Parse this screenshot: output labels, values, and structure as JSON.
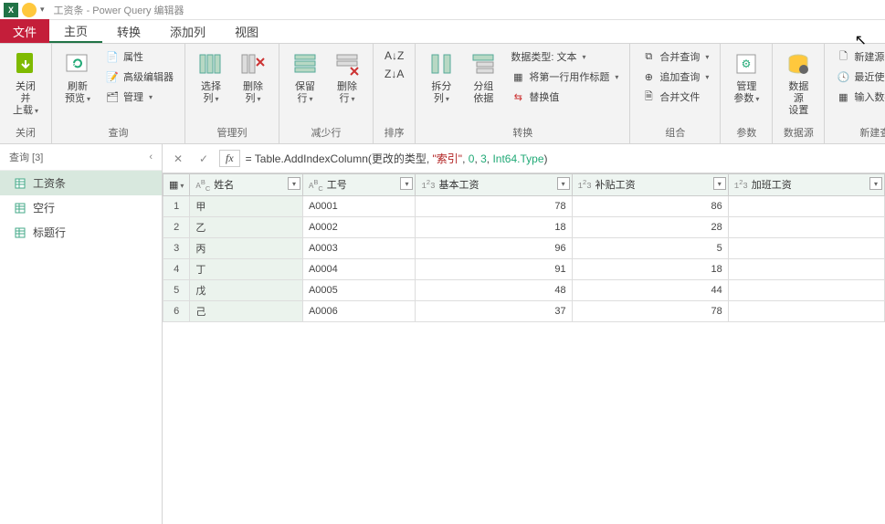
{
  "titlebar": {
    "title": "工资条 - Power Query 编辑器"
  },
  "tabs": {
    "file": "文件",
    "home": "主页",
    "transform": "转换",
    "addcol": "添加列",
    "view": "视图"
  },
  "ribbon": {
    "close_load": "关闭并\n上载",
    "close_group": "关闭",
    "refresh": "刷新\n预览",
    "props": "属性",
    "adv": "高级编辑器",
    "manage": "管理",
    "query_group": "查询",
    "choose_cols": "选择\n列",
    "remove_cols": "删除\n列",
    "managecols_group": "管理列",
    "keep_rows": "保留\n行",
    "remove_rows": "删除\n行",
    "reduce_group": "减少行",
    "sort_group": "排序",
    "split_col": "拆分\n列",
    "group_by": "分组\n依据",
    "datatype": "数据类型: 文本",
    "first_row": "将第一行用作标题",
    "replace": "替换值",
    "transform_group": "转换",
    "merge": "合并查询",
    "append": "追加查询",
    "combine_files": "合并文件",
    "combine_group": "组合",
    "params": "管理\n参数",
    "params_group": "参数",
    "ds_settings": "数据源\n设置",
    "ds_group": "数据源",
    "new_source": "新建源",
    "recent": "最近使用的源",
    "enter_data": "输入数据",
    "newq_group": "新建查询"
  },
  "queries": {
    "header": "查询 [3]",
    "items": [
      "工资条",
      "空行",
      "标题行"
    ]
  },
  "formula": {
    "pre": "= Table.AddIndexColumn(更改的类型, ",
    "str": "\"索引\"",
    "c1": ", ",
    "n0": "0",
    "c2": ", ",
    "n3": "3",
    "c3": ", ",
    "typ": "Int64.Type",
    "post": ")"
  },
  "columns": [
    {
      "label": "姓名",
      "type": "ABC"
    },
    {
      "label": "工号",
      "type": "ABC"
    },
    {
      "label": "基本工资",
      "type": "123"
    },
    {
      "label": "补贴工资",
      "type": "123"
    },
    {
      "label": "加班工资",
      "type": "123"
    }
  ],
  "rows": [
    {
      "n": "1",
      "name": "甲",
      "id": "A0001",
      "base": "78",
      "allow": "86",
      "ot": ""
    },
    {
      "n": "2",
      "name": "乙",
      "id": "A0002",
      "base": "18",
      "allow": "28",
      "ot": ""
    },
    {
      "n": "3",
      "name": "丙",
      "id": "A0003",
      "base": "96",
      "allow": "5",
      "ot": ""
    },
    {
      "n": "4",
      "name": "丁",
      "id": "A0004",
      "base": "91",
      "allow": "18",
      "ot": ""
    },
    {
      "n": "5",
      "name": "戊",
      "id": "A0005",
      "base": "48",
      "allow": "44",
      "ot": ""
    },
    {
      "n": "6",
      "name": "己",
      "id": "A0006",
      "base": "37",
      "allow": "78",
      "ot": ""
    }
  ]
}
